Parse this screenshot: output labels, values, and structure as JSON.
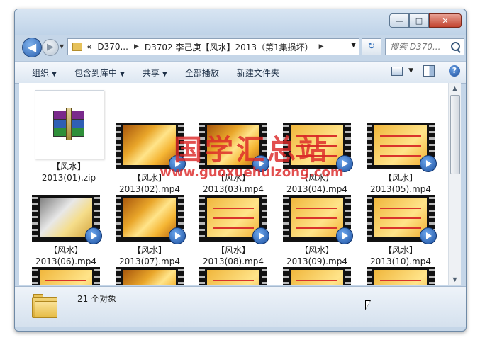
{
  "window": {
    "controls": {
      "minimize": "—",
      "maximize": "□",
      "close": "✕"
    }
  },
  "navigation": {
    "back_label": "◀",
    "forward_label": "▶",
    "breadcrumb": [
      "D370...",
      "D3702 李己庚【风水】2013（第1集损坏）"
    ],
    "overflow_label": "«",
    "search_placeholder": "搜索 D370...",
    "refresh_label": "↻"
  },
  "toolbar": {
    "organize": "组织",
    "include_in_library": "包含到库中",
    "share": "共享",
    "play_all": "全部播放",
    "new_folder": "新建文件夹",
    "help": "?"
  },
  "items": [
    {
      "name_line1": "【风水】",
      "name_line2": "2013(01).zip",
      "type": "zip"
    },
    {
      "name_line1": "【风水】",
      "name_line2": "2013(02).mp4",
      "type": "video-plain"
    },
    {
      "name_line1": "【风水】",
      "name_line2": "2013(03).mp4",
      "type": "video-plain"
    },
    {
      "name_line1": "【风水】",
      "name_line2": "2013(04).mp4",
      "type": "video-poster"
    },
    {
      "name_line1": "【风水】",
      "name_line2": "2013(05).mp4",
      "type": "video-poster"
    },
    {
      "name_line1": "【风水】",
      "name_line2": "2013(06).mp4",
      "type": "video-photo"
    },
    {
      "name_line1": "【风水】",
      "name_line2": "2013(07).mp4",
      "type": "video-plain"
    },
    {
      "name_line1": "【风水】",
      "name_line2": "2013(08).mp4",
      "type": "video-poster"
    },
    {
      "name_line1": "【风水】",
      "name_line2": "2013(09).mp4",
      "type": "video-poster"
    },
    {
      "name_line1": "【风水】",
      "name_line2": "2013(10).mp4",
      "type": "video-poster"
    },
    {
      "type": "video-poster"
    },
    {
      "type": "video-plain"
    },
    {
      "type": "video-poster"
    },
    {
      "type": "video-poster"
    },
    {
      "type": "video-poster"
    }
  ],
  "status": {
    "count_text": "21 个对象"
  },
  "watermark": {
    "text_cn": "国学汇总站",
    "url": "www.guoxuehuizong.com"
  },
  "colors": {
    "accent": "#2a5fae",
    "watermark": "#dc2828",
    "poster_text": "#e0231b"
  }
}
